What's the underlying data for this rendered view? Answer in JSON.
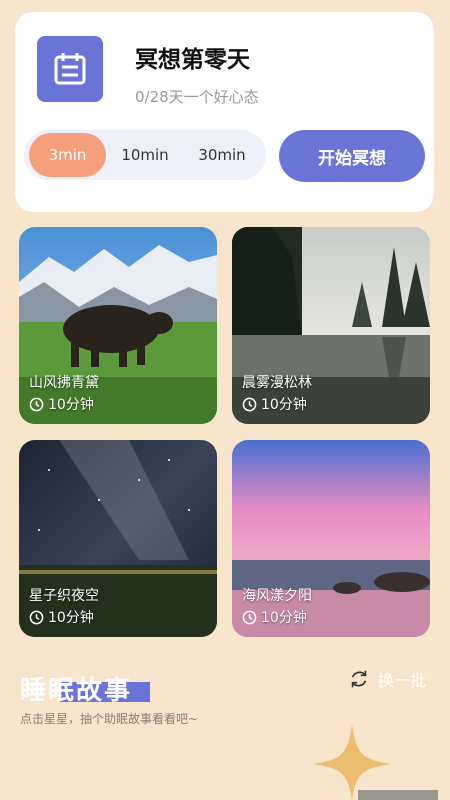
{
  "header": {
    "title": "冥想第零天",
    "subtitle": "0/28天一个好心态"
  },
  "durations": [
    {
      "label": "3min",
      "selected": true
    },
    {
      "label": "10min",
      "selected": false
    },
    {
      "label": "30min",
      "selected": false
    }
  ],
  "start_button": "开始冥想",
  "tiles": [
    {
      "title": "山风拂青黛",
      "duration": "10分钟"
    },
    {
      "title": "晨雾漫松林",
      "duration": "10分钟"
    },
    {
      "title": "星子织夜空",
      "duration": "10分钟"
    },
    {
      "title": "海风漾夕阳",
      "duration": "10分钟"
    }
  ],
  "stories": {
    "title": "睡眠故事",
    "hint": "点击星星，抽个助眠故事看看吧~",
    "refresh": "换一批"
  },
  "colors": {
    "accent": "#6a74d6",
    "selected": "#f6a07b",
    "background": "#f7e6cc",
    "star": "#ecbe72"
  },
  "icons": {
    "app": "calendar-icon",
    "clock": "clock-icon",
    "refresh": "refresh-icon",
    "star": "star-icon"
  }
}
